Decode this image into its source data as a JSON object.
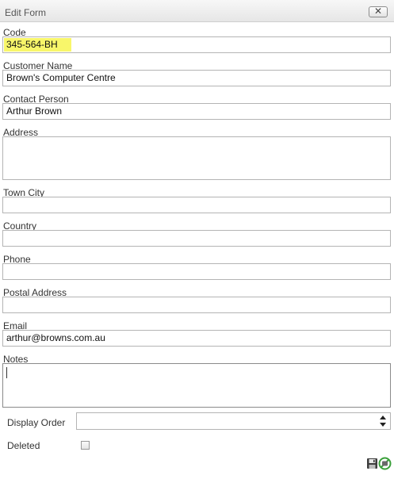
{
  "dialog": {
    "title": "Edit Form",
    "close_symbol": "✕"
  },
  "fields": {
    "code": {
      "label": "Code",
      "value": "345-564-BH"
    },
    "customer_name": {
      "label": "Customer Name",
      "value": "Brown's Computer Centre"
    },
    "contact_person": {
      "label": "Contact Person",
      "value": "Arthur Brown"
    },
    "address": {
      "label": "Address",
      "value": ""
    },
    "town_city": {
      "label": "Town City",
      "value": ""
    },
    "country": {
      "label": "Country",
      "value": ""
    },
    "phone": {
      "label": "Phone",
      "value": ""
    },
    "postal_address": {
      "label": "Postal Address",
      "value": ""
    },
    "email": {
      "label": "Email",
      "value": "arthur@browns.com.au"
    },
    "notes": {
      "label": "Notes",
      "value": ""
    },
    "display_order": {
      "label": "Display Order",
      "value": ""
    },
    "deleted": {
      "label": "Deleted",
      "checked": false
    }
  },
  "icons": {
    "close": "close-icon",
    "save": "save-icon",
    "cancel": "cancel-icon",
    "spinner": "spinner-arrows-icon"
  },
  "colors": {
    "highlight": "#f8f66a",
    "cancel_green": "#3aa03a"
  }
}
